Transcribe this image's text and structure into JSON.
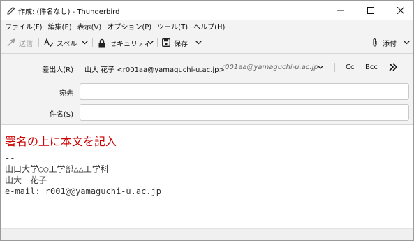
{
  "window": {
    "title": "作成: (件名なし) - Thunderbird"
  },
  "menu": [
    "ファイル(F)",
    "編集(E)",
    "表示(V)",
    "オプション(P)",
    "ツール(T)",
    "ヘルプ(H)"
  ],
  "toolbar": {
    "send_label": "送信",
    "spell_label": "スペル",
    "security_label": "セキュリティ",
    "save_label": "保存",
    "attach_label": "添付"
  },
  "header": {
    "from_label": "差出人(R)",
    "from_value": "山大 花子 <r001aa@yamaguchi-u.ac.jp>",
    "from_identity": "r001aa@yamaguchi-u.ac.jp",
    "cc_label": "Cc",
    "bcc_label": "Bcc",
    "to_label": "宛先",
    "to_value": "",
    "subject_label": "件名(S)",
    "subject_value": ""
  },
  "body": {
    "heading": "署名の上に本文を記入",
    "heading_color": "#cc0000",
    "signature": [
      "--",
      "山口大学○○工学部△△工学科",
      "山大　花子",
      "e-mail: r001@@yamaguchi-u.ac.jp"
    ]
  }
}
